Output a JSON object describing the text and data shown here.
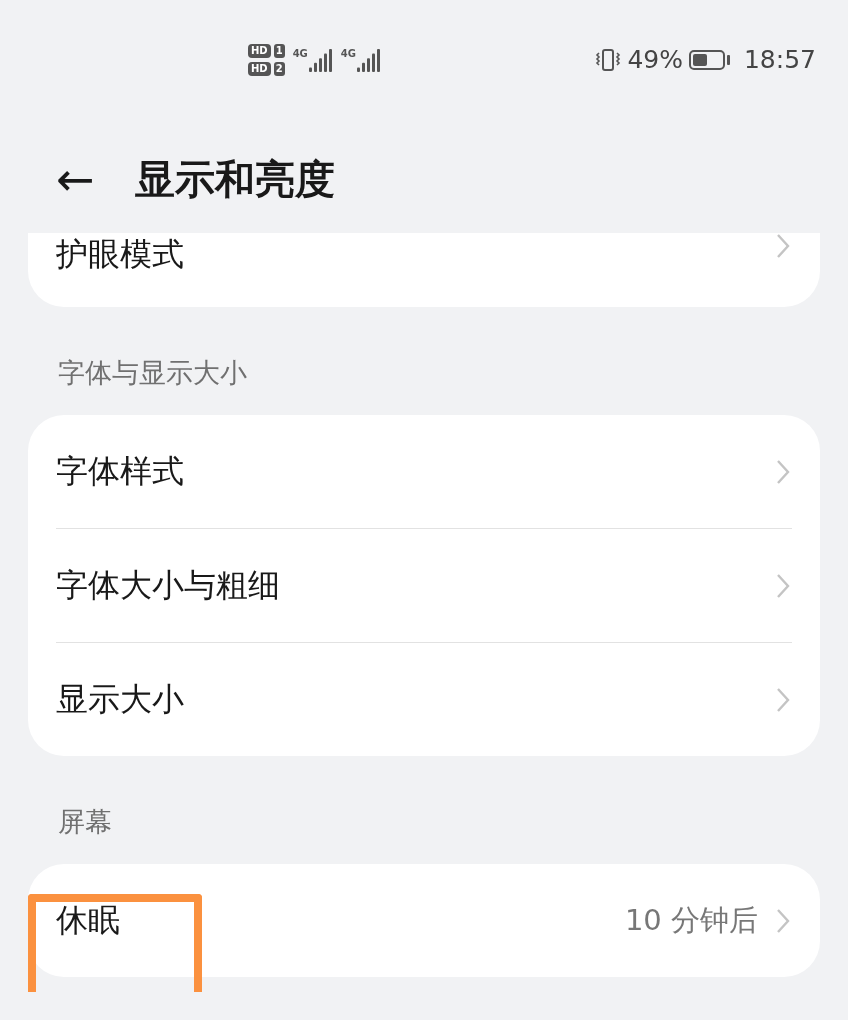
{
  "status_bar": {
    "sims": [
      {
        "badge": "HD",
        "slot": "1",
        "network": "4G"
      },
      {
        "badge": "HD",
        "slot": "2",
        "network": "4G"
      }
    ],
    "battery_percent": "49%",
    "time": "18:57"
  },
  "header": {
    "back": "←",
    "title": "显示和亮度"
  },
  "sections": [
    {
      "items": [
        {
          "label": "护眼模式",
          "highlighted": false
        }
      ]
    },
    {
      "label": "字体与显示大小",
      "items": [
        {
          "label": "字体样式",
          "highlighted": false
        },
        {
          "label": "字体大小与粗细",
          "highlighted": false
        },
        {
          "label": "显示大小",
          "highlighted": false
        }
      ]
    },
    {
      "label": "屏幕",
      "items": [
        {
          "label": "休眠",
          "value": "10 分钟后",
          "highlighted": true
        }
      ]
    }
  ]
}
